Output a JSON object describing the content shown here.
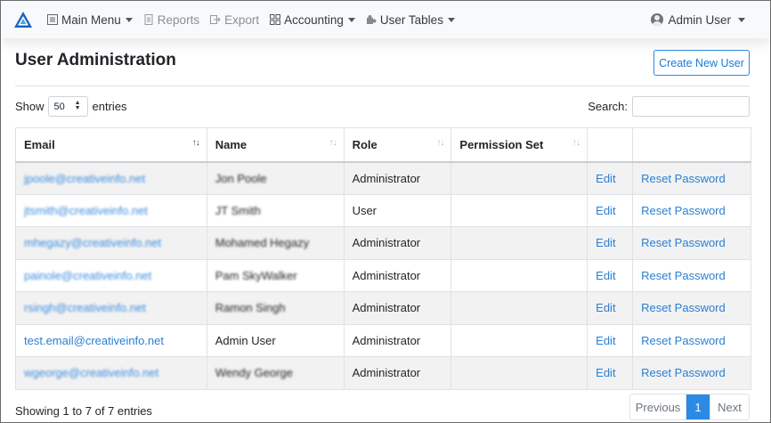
{
  "nav": {
    "items": [
      {
        "label": "Main Menu",
        "icon": "list-icon",
        "dropdown": true,
        "muted": false
      },
      {
        "label": "Reports",
        "icon": "document-icon",
        "dropdown": false,
        "muted": true
      },
      {
        "label": "Export",
        "icon": "export-icon",
        "dropdown": false,
        "muted": true
      },
      {
        "label": "Accounting",
        "icon": "grid-icon",
        "dropdown": true,
        "muted": false
      },
      {
        "label": "User Tables",
        "icon": "puzzle-icon",
        "dropdown": true,
        "muted": false
      }
    ],
    "user_label": "Admin User"
  },
  "page": {
    "title": "User Administration",
    "create_button": "Create New User"
  },
  "controls": {
    "show_label": "Show",
    "entries_value": "50",
    "entries_label": "entries",
    "search_label": "Search:",
    "search_value": ""
  },
  "table": {
    "columns": [
      "Email",
      "Name",
      "Role",
      "Permission Set",
      "",
      ""
    ],
    "rows": [
      {
        "email": "jpoole@creativeinfo.net",
        "name": "Jon Poole",
        "role": "Administrator",
        "permission_set": "",
        "edit": "Edit",
        "reset": "Reset Password",
        "blurred": true
      },
      {
        "email": "jtsmith@creativeinfo.net",
        "name": "JT Smith",
        "role": "User",
        "permission_set": "",
        "edit": "Edit",
        "reset": "Reset Password",
        "blurred": true
      },
      {
        "email": "mhegazy@creativeinfo.net",
        "name": "Mohamed Hegazy",
        "role": "Administrator",
        "permission_set": "",
        "edit": "Edit",
        "reset": "Reset Password",
        "blurred": true
      },
      {
        "email": "painole@creativeinfo.net",
        "name": "Pam SkyWalker",
        "role": "Administrator",
        "permission_set": "",
        "edit": "Edit",
        "reset": "Reset Password",
        "blurred": true
      },
      {
        "email": "rsingh@creativeinfo.net",
        "name": "Ramon Singh",
        "role": "Administrator",
        "permission_set": "",
        "edit": "Edit",
        "reset": "Reset Password",
        "blurred": true
      },
      {
        "email": "test.email@creativeinfo.net",
        "name": "Admin User",
        "role": "Administrator",
        "permission_set": "",
        "edit": "Edit",
        "reset": "Reset Password",
        "blurred": false
      },
      {
        "email": "wgeorge@creativeinfo.net",
        "name": "Wendy George",
        "role": "Administrator",
        "permission_set": "",
        "edit": "Edit",
        "reset": "Reset Password",
        "blurred": true
      }
    ]
  },
  "footer": {
    "info": "Showing 1 to 7 of 7 entries",
    "previous": "Previous",
    "current_page": "1",
    "next": "Next"
  },
  "colors": {
    "accent": "#2b8ae4",
    "link": "#2a7fd4",
    "navbar_bg": "#f8f9fa",
    "stripe": "#f2f2f2"
  }
}
